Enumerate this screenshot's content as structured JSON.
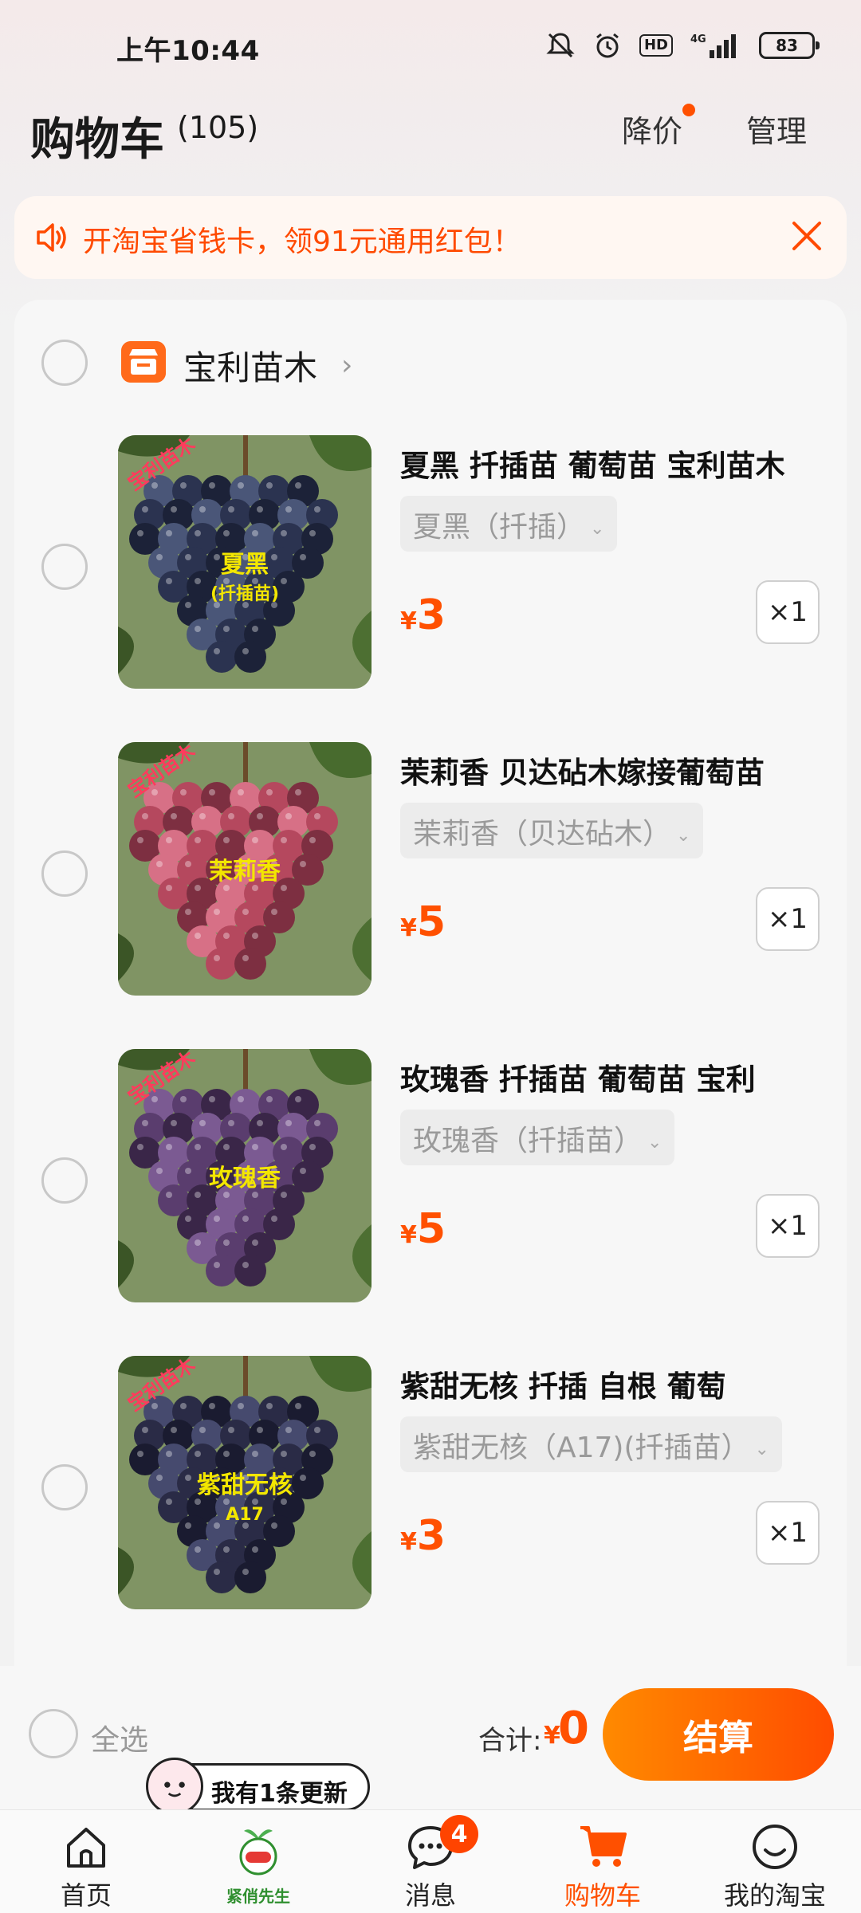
{
  "status_bar": {
    "time": "上午10:44",
    "network": "4G",
    "hd": "HD",
    "battery": "83"
  },
  "header": {
    "title": "购物车",
    "count": "(105)",
    "price_drop": "降价",
    "manage": "管理"
  },
  "promo": {
    "text": "开淘宝省钱卡，领91元通用红包！"
  },
  "store": {
    "name": "宝利苗木"
  },
  "items": [
    {
      "title": "夏黑 扦插苗 葡萄苗  宝利苗木",
      "sku": "夏黑（扦插）",
      "currency": "¥",
      "price": "3",
      "qty": "×1",
      "img_text": "夏黑",
      "img_sub": "(扦插苗)",
      "img_watermark": "宝利苗木",
      "img_colors": [
        "#2b3350",
        "#4a5678",
        "#1c2238"
      ]
    },
    {
      "title": "茉莉香 贝达砧木嫁接葡萄苗",
      "sku": "茉莉香（贝达砧木）",
      "currency": "¥",
      "price": "5",
      "qty": "×1",
      "img_text": "茉莉香",
      "img_sub": "",
      "img_watermark": "宝利苗木",
      "img_colors": [
        "#b5485e",
        "#d77086",
        "#7d2f41"
      ]
    },
    {
      "title": "玫瑰香 扦插苗  葡萄苗  宝利",
      "sku": "玫瑰香（扦插苗）",
      "currency": "¥",
      "price": "5",
      "qty": "×1",
      "img_text": "玫瑰香",
      "img_sub": "",
      "img_watermark": "宝利苗木",
      "img_colors": [
        "#5a3d6e",
        "#7b5a92",
        "#3a2648"
      ]
    },
    {
      "title": "紫甜无核    扦插  自根  葡萄",
      "sku": "紫甜无核（A17)(扦插苗）",
      "currency": "¥",
      "price": "3",
      "qty": "×1",
      "img_text": "紫甜无核",
      "img_sub": "A17",
      "img_watermark": "宝利苗木",
      "img_colors": [
        "#2a2b46",
        "#464a6e",
        "#1a1b30"
      ]
    }
  ],
  "checkout": {
    "select_all": "全选",
    "total_label": "合计:",
    "currency": "¥",
    "total": "0",
    "button": "结算"
  },
  "bubble": {
    "text": "我有1条更新"
  },
  "tabs": [
    {
      "label": "首页",
      "icon": "home-icon"
    },
    {
      "label": "紧俏先生",
      "icon": "mascot-icon"
    },
    {
      "label": "消息",
      "icon": "message-icon",
      "badge": "4"
    },
    {
      "label": "购物车",
      "icon": "cart-icon",
      "active": true
    },
    {
      "label": "我的淘宝",
      "icon": "profile-icon"
    }
  ],
  "colors": {
    "accent": "#ff5000",
    "checkout_gradient": [
      "#ff8a00",
      "#ff4c00"
    ]
  }
}
